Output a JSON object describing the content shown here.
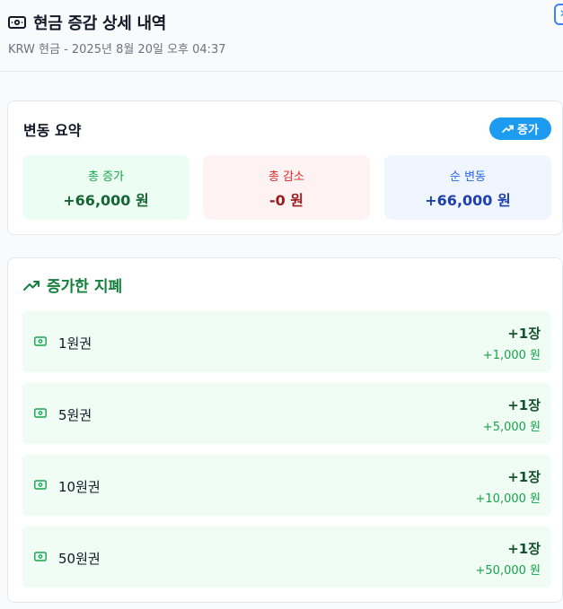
{
  "header": {
    "title": "현금 증감 상세 내역",
    "subtitle": "KRW 현금 - 2025년 8월 20일 오후 04:37",
    "icon": "cash-icon",
    "close_icon": "close-icon"
  },
  "summary": {
    "title": "변동 요약",
    "badge": "증가",
    "badge_icon": "trending-up-icon",
    "increase": {
      "label": "총 증가",
      "value": "+66,000 원"
    },
    "decrease": {
      "label": "총 감소",
      "value": "-0 원"
    },
    "net": {
      "label": "순 변동",
      "value": "+66,000 원"
    }
  },
  "bills": {
    "title": "증가한 지폐",
    "icon": "trending-up-icon",
    "items": [
      {
        "name": "1원권",
        "count": "+1장",
        "amount": "+1,000 원"
      },
      {
        "name": "5원권",
        "count": "+1장",
        "amount": "+5,000 원"
      },
      {
        "name": "10원권",
        "count": "+1장",
        "amount": "+10,000 원"
      },
      {
        "name": "50원권",
        "count": "+1장",
        "amount": "+50,000 원"
      }
    ]
  },
  "colors": {
    "accent": "#1d9bf0",
    "increase_green": "#16a34a",
    "decrease_red": "#dc2626",
    "net_blue": "#2563eb"
  }
}
